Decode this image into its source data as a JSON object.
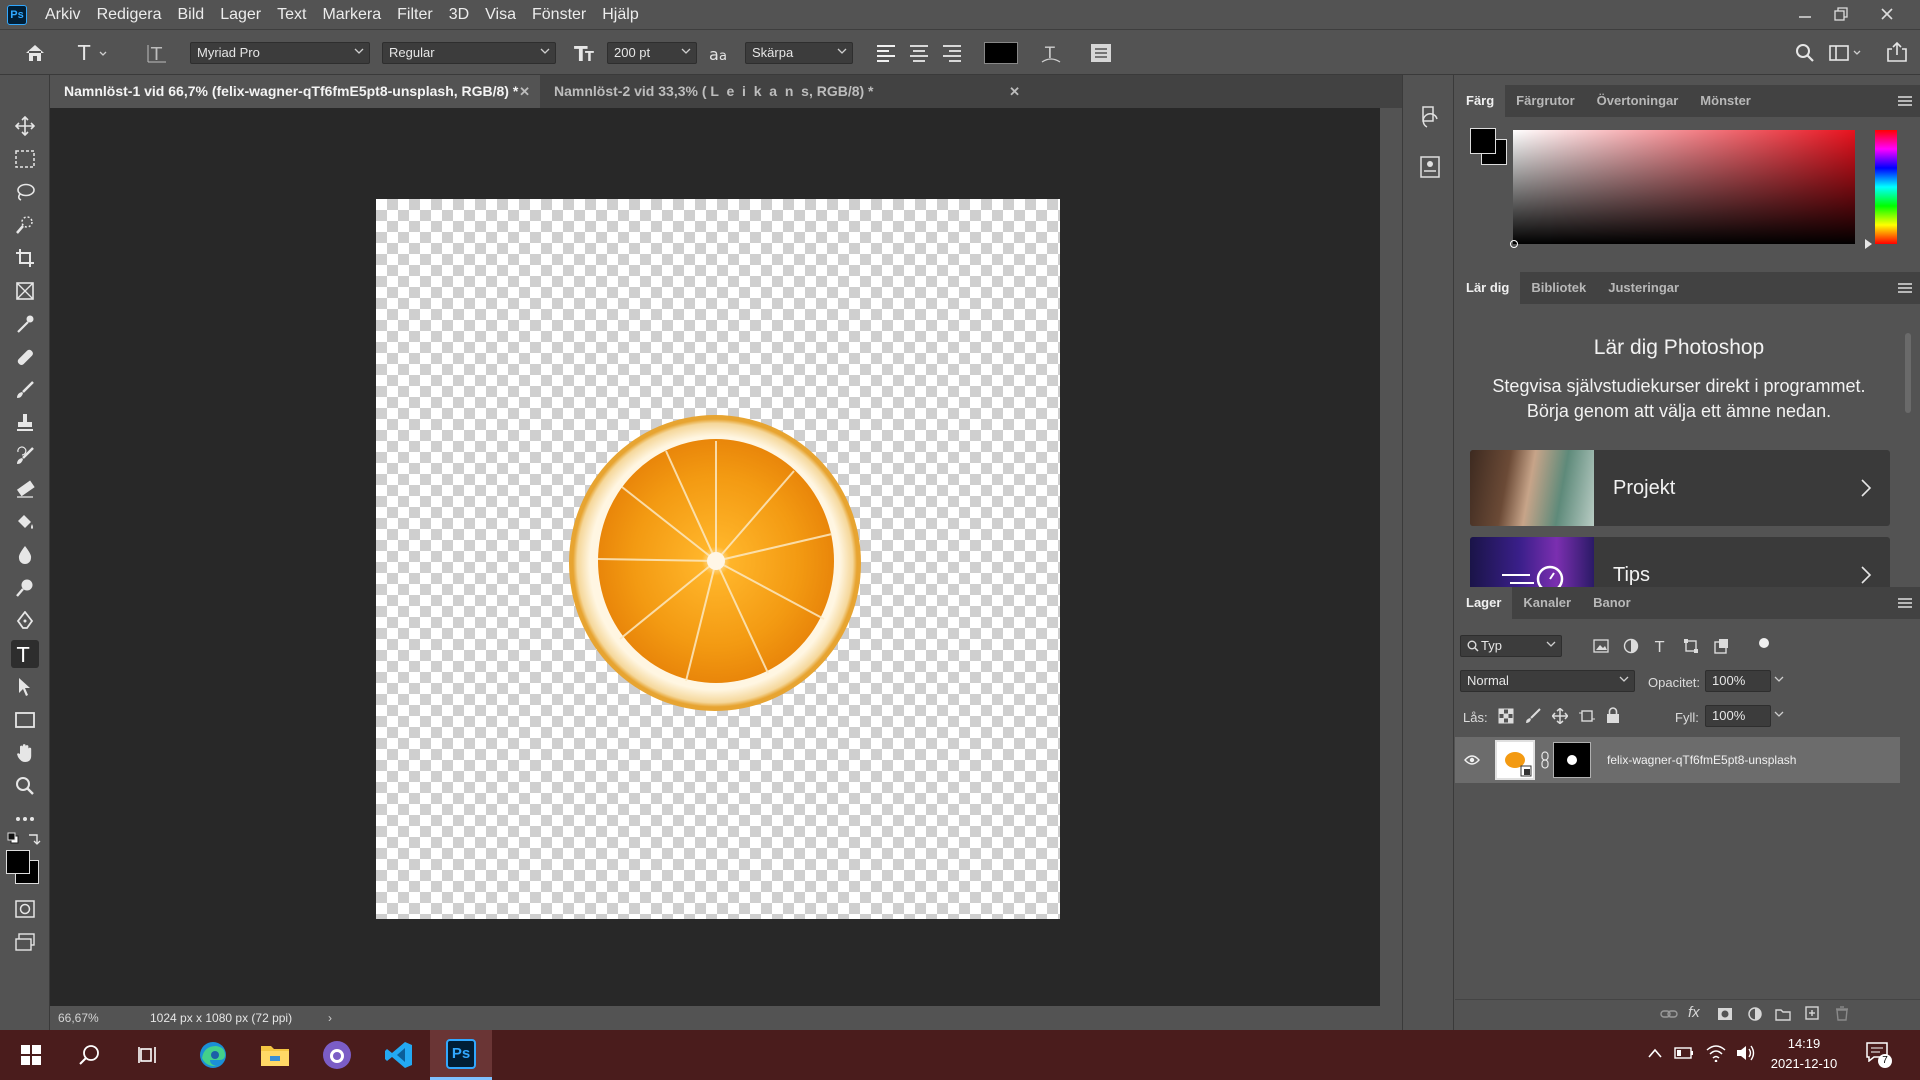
{
  "app": {
    "logo_text": "Ps"
  },
  "menu": [
    "Arkiv",
    "Redigera",
    "Bild",
    "Lager",
    "Text",
    "Markera",
    "Filter",
    "3D",
    "Visa",
    "Fönster",
    "Hjälp"
  ],
  "options_bar": {
    "font_family": "Myriad Pro",
    "font_style": "Regular",
    "font_size": "200 pt",
    "antialias_glyph": "a",
    "antialias": "Skärpa",
    "text_color": "#000000"
  },
  "tabs": [
    {
      "label": "Namnlöst-1 vid 66,7% (felix-wagner-qTf6fmE5pt8-unsplash, RGB/8) *",
      "active": true
    },
    {
      "label": "Namnlöst-2 vid 33,3% ( L  e  i  k  a  n  s, RGB/8) *",
      "active": false
    }
  ],
  "statusbar": {
    "zoom": "66,67%",
    "doc_info": "1024 px x 1080 px (72 ppi)"
  },
  "color_panel": {
    "tabs": [
      "Färg",
      "Färgrutor",
      "Övertoningar",
      "Mönster"
    ],
    "hue_color": "#e8121e"
  },
  "learn_panel": {
    "tabs": [
      "Lär dig",
      "Bibliotek",
      "Justeringar"
    ],
    "title": "Lär dig Photoshop",
    "subtitle_line1": "Stegvisa självstudiekurser direkt i programmet.",
    "subtitle_line2": "Börja genom att välja ett ämne nedan.",
    "cards": [
      "Projekt",
      "Tips"
    ]
  },
  "layers_panel": {
    "tabs": [
      "Lager",
      "Kanaler",
      "Banor"
    ],
    "filter": "Typ",
    "blend_mode": "Normal",
    "opacity_label": "Opacitet:",
    "opacity": "100%",
    "lock_label": "Lås:",
    "fill_label": "Fyll:",
    "fill": "100%",
    "layers": [
      {
        "name": "felix-wagner-qTf6fmE5pt8-unsplash",
        "visible": true
      }
    ]
  },
  "taskbar": {
    "time": "14:19",
    "date": "2021-12-10",
    "notifications": "7",
    "ps_label": "Ps"
  }
}
